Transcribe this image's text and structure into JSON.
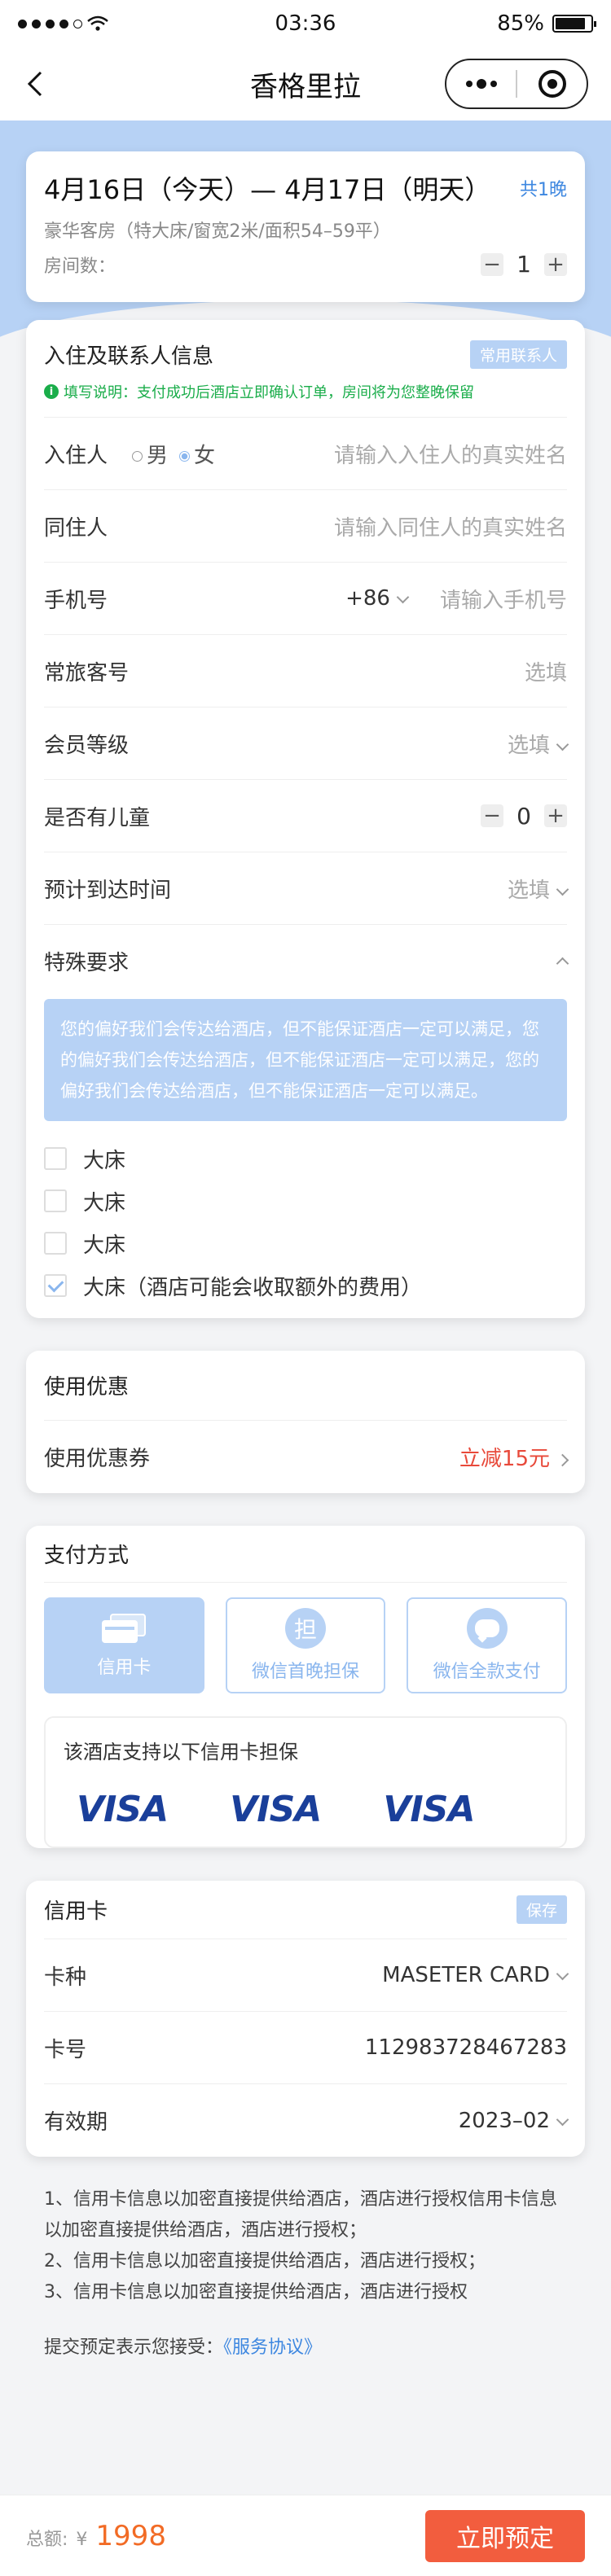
{
  "status_bar": {
    "time": "03:36",
    "battery": "85%",
    "battery_level": 0.85
  },
  "nav": {
    "title": "香格里拉"
  },
  "booking": {
    "dates": "4月16日（今天）— 4月17日（明天）",
    "nights": "共1晚",
    "room_desc": "豪华客房（特大床/窗宽2米/面积54–59平）",
    "room_label": "房间数：",
    "room_count": "1"
  },
  "guest": {
    "title": "入住及联系人信息",
    "contacts_btn": "常用联系人",
    "notice": "填写说明：支付成功后酒店立即确认订单，房间将为您整晚保留",
    "resident_label": "入住人",
    "male": "男",
    "female": "女",
    "resident_placeholder": "请输入入住人的真实姓名",
    "companion_label": "同住人",
    "companion_placeholder": "请输入同住人的真实姓名",
    "phone_label": "手机号",
    "phone_code": "+86",
    "phone_placeholder": "请输入手机号",
    "traveler_label": "常旅客号",
    "traveler_placeholder": "选填",
    "member_label": "会员等级",
    "member_placeholder": "选填",
    "children_label": "是否有儿童",
    "children_count": "0",
    "arrival_label": "预计到达时间",
    "arrival_placeholder": "选填",
    "special_label": "特殊要求",
    "special_notice": "您的偏好我们会传达给酒店，但不能保证酒店一定可以满足，您的偏好我们会传达给酒店，但不能保证酒店一定可以满足，您的偏好我们会传达给酒店，但不能保证酒店一定可以满足。",
    "options": [
      {
        "label": "大床",
        "checked": false
      },
      {
        "label": "大床",
        "checked": false
      },
      {
        "label": "大床",
        "checked": false
      },
      {
        "label": "大床（酒店可能会收取额外的费用）",
        "checked": true
      }
    ]
  },
  "coupon": {
    "title": "使用优惠",
    "label": "使用优惠券",
    "value": "立减15元"
  },
  "payment": {
    "title": "支付方式",
    "options": [
      "信用卡",
      "微信首晚担保",
      "微信全款支付"
    ],
    "guarantee_icon_char": "担",
    "support_title": "该酒店支持以下信用卡担保",
    "brands": [
      "VISA",
      "VISA",
      "VISA"
    ]
  },
  "credit_card": {
    "title": "信用卡",
    "save_btn": "保存",
    "type_label": "卡种",
    "type_value": "MASETER CARD",
    "number_label": "卡号",
    "number_value": "112983728467283",
    "expiry_label": "有效期",
    "expiry_value": "2023–02"
  },
  "notes": [
    "1、信用卡信息以加密直接提供给酒店，酒店进行授权信用卡信息以加密直接提供给酒店，酒店进行授权；",
    "2、信用卡信息以加密直接提供给酒店，酒店进行授权；",
    "3、信用卡信息以加密直接提供给酒店，酒店进行授权"
  ],
  "agreement": {
    "text": "提交预定表示您接受：",
    "link": "《服务协议》"
  },
  "footer": {
    "total_label": "总额:",
    "currency": "¥",
    "price": "1998",
    "book_btn": "立即预定"
  },
  "colors": {
    "accent": "#b7d2f5",
    "price": "#f26b25",
    "button": "#f25d3e",
    "notice": "#1aad4a",
    "link": "#3d87e0"
  }
}
